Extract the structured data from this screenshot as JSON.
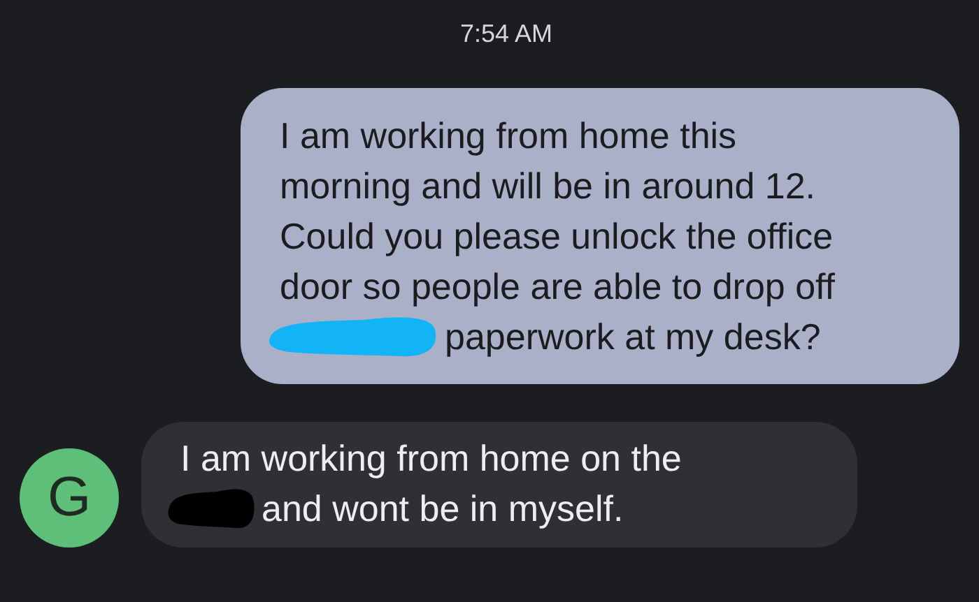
{
  "timestamp": "7:54 AM",
  "messages": [
    {
      "kind": "outgoing",
      "lines": [
        {
          "text": "I am working from home this"
        },
        {
          "text": "morning and will be in around 12."
        },
        {
          "text": "Could you please unlock the office"
        },
        {
          "text": "door so people are able to drop off"
        },
        {
          "text": "paperwork at my desk?",
          "redaction": {
            "color": "#12b4f6"
          }
        }
      ]
    },
    {
      "kind": "incoming",
      "avatar": "G",
      "lines": [
        {
          "text": "I am working from home on the"
        },
        {
          "text": "and wont be in myself.",
          "redaction": {
            "color": "#000000"
          }
        }
      ]
    }
  ]
}
